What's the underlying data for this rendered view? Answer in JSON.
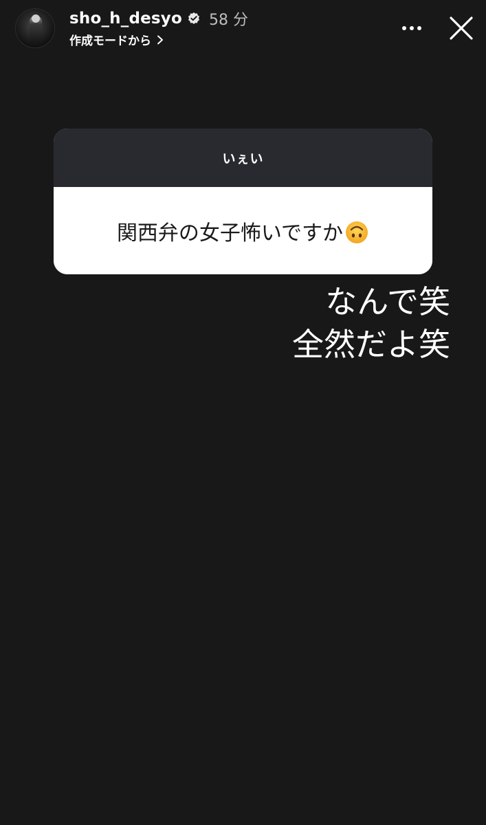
{
  "header": {
    "username": "sho_h_desyo",
    "time_ago": "58 分",
    "subtitle": "作成モードから",
    "icons": {
      "verified": "verified-badge-icon",
      "chevron": "chevron-right-icon",
      "more": "more-horizontal-icon",
      "close": "close-icon"
    }
  },
  "question_card": {
    "header_text": "いぇい",
    "question_text": "関西弁の女子怖いですか",
    "emoji": "upside-down-face-emoji"
  },
  "reply": {
    "lines": [
      "なんで笑",
      "全然だよ笑"
    ]
  },
  "colors": {
    "background": "#181818",
    "card_header": "#282a30",
    "card_body": "#ffffff",
    "emoji_yellow": "#f5b92e"
  }
}
